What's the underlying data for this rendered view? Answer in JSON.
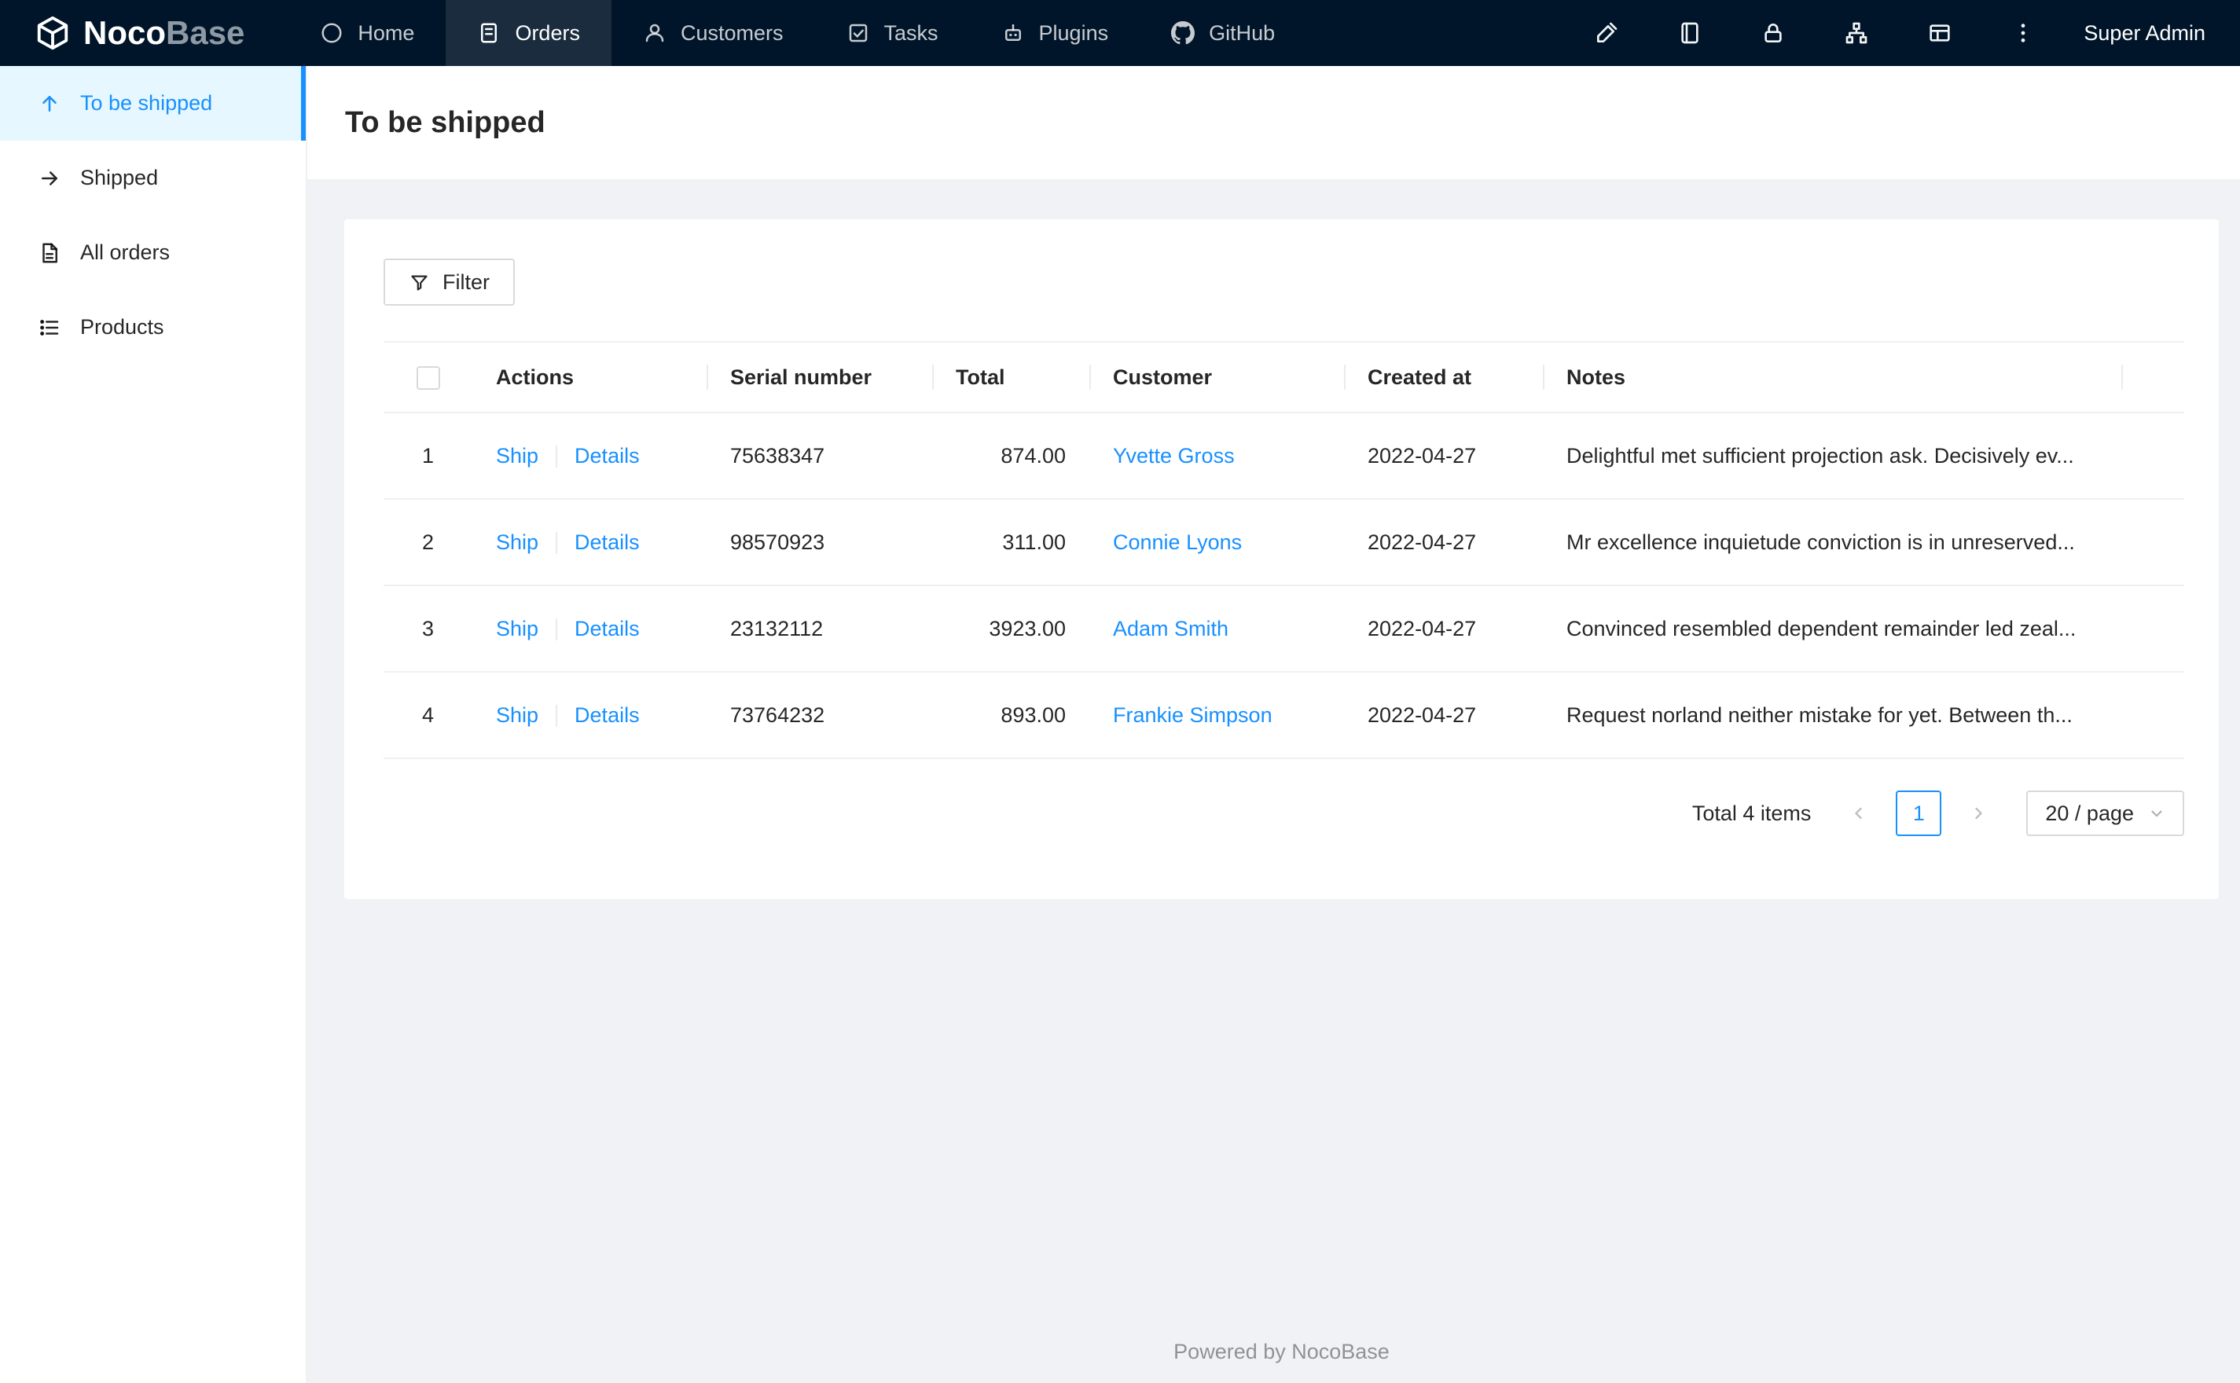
{
  "colors": {
    "accent": "#1890ff",
    "navbar_bg": "#001529",
    "sidebar_selected_bg": "#e6f7ff",
    "page_bg": "#f0f2f5",
    "link": "#1890ff"
  },
  "brand": {
    "name_primary": "Noco",
    "name_secondary": "Base",
    "logo_icon": "nocobase-logo-icon"
  },
  "topnav": {
    "items": [
      {
        "label": "Home",
        "icon": "home-icon"
      },
      {
        "label": "Orders",
        "icon": "orders-icon"
      },
      {
        "label": "Customers",
        "icon": "customers-icon"
      },
      {
        "label": "Tasks",
        "icon": "tasks-icon"
      },
      {
        "label": "Plugins",
        "icon": "plugins-icon"
      },
      {
        "label": "GitHub",
        "icon": "github-icon"
      }
    ],
    "active_item": "Orders",
    "right_icons": [
      "highlighter-icon",
      "notebook-icon",
      "lock-icon",
      "collaboration-icon",
      "layout-icon",
      "more-icon"
    ],
    "user_label": "Super Admin"
  },
  "sidebar": {
    "items": [
      {
        "label": "To be shipped",
        "icon": "arrow-up-icon"
      },
      {
        "label": "Shipped",
        "icon": "arrow-right-icon"
      },
      {
        "label": "All orders",
        "icon": "document-icon"
      },
      {
        "label": "Products",
        "icon": "list-icon"
      }
    ],
    "active_item": "To be shipped"
  },
  "page": {
    "title": "To be shipped"
  },
  "toolbar": {
    "filter_label": "Filter",
    "filter_icon": "filter-icon"
  },
  "table": {
    "columns": {
      "actions": "Actions",
      "serial": "Serial number",
      "total": "Total",
      "customer": "Customer",
      "created": "Created at",
      "notes": "Notes"
    },
    "action_labels": {
      "ship": "Ship",
      "details": "Details"
    },
    "rows": [
      {
        "index": "1",
        "serial": "75638347",
        "total": "874.00",
        "customer": "Yvette Gross",
        "created": "2022-04-27",
        "notes": "Delightful met sufficient projection ask. Decisively ev..."
      },
      {
        "index": "2",
        "serial": "98570923",
        "total": "311.00",
        "customer": "Connie Lyons",
        "created": "2022-04-27",
        "notes": "Mr excellence inquietude conviction is in unreserved..."
      },
      {
        "index": "3",
        "serial": "23132112",
        "total": "3923.00",
        "customer": "Adam Smith",
        "created": "2022-04-27",
        "notes": "Convinced resembled dependent remainder led zeal..."
      },
      {
        "index": "4",
        "serial": "73764232",
        "total": "893.00",
        "customer": "Frankie Simpson",
        "created": "2022-04-27",
        "notes": "Request norland neither mistake for yet. Between th..."
      }
    ]
  },
  "pagination": {
    "total_text": "Total 4 items",
    "current_page": "1",
    "page_size_label": "20 / page"
  },
  "footer": {
    "text": "Powered by NocoBase"
  }
}
